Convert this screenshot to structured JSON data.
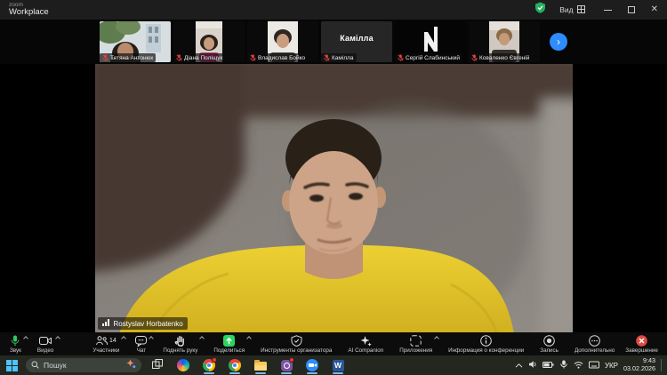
{
  "window": {
    "app_small": "zoom",
    "app_name": "Workplace",
    "view_label": "Вид",
    "icons": [
      "shield-check-icon",
      "grid-view-icon",
      "minimize-icon",
      "maximize-icon",
      "close-icon"
    ]
  },
  "filmstrip": {
    "participants": [
      {
        "name": "Тетяна Антонюк",
        "muted": true,
        "active_speaker": true
      },
      {
        "name": "Діана Поліщук",
        "muted": true
      },
      {
        "name": "Владислав Бойко",
        "muted": true
      },
      {
        "name": "Камілла",
        "center_label": "Камілла",
        "muted": true
      },
      {
        "name": "Сергій Слабинський",
        "muted": true,
        "logo": "N-monogram"
      },
      {
        "name": "Коваленко Євгеній",
        "muted": true
      }
    ],
    "next_arrow_icon": "chevron-right-icon"
  },
  "main_video": {
    "speaker": "Rostyslav Horbatenko",
    "signal_icon": "audio-level-bars-icon"
  },
  "toolbar": {
    "items": [
      {
        "label": "Звук",
        "icon": "microphone-icon",
        "chevron": true
      },
      {
        "label": "Видео",
        "icon": "camera-icon",
        "chevron": true
      },
      {
        "label": "Участники",
        "icon": "participants-icon",
        "count": "14",
        "chevron": true
      },
      {
        "label": "Чат",
        "icon": "chat-bubble-icon",
        "chevron": true
      },
      {
        "label": "Поднять руку",
        "icon": "raise-hand-icon",
        "chevron": true
      },
      {
        "label": "Поделиться",
        "icon": "share-screen-icon",
        "chevron": true
      },
      {
        "label": "Инструменты организатора",
        "icon": "shield-icon"
      },
      {
        "label": "AI Companion",
        "icon": "sparkle-icon"
      },
      {
        "label": "Приложения",
        "icon": "apps-icon",
        "chevron": true
      },
      {
        "label": "Информация о конференции",
        "icon": "info-icon"
      },
      {
        "label": "Запись",
        "icon": "record-icon"
      },
      {
        "label": "Дополнительно",
        "icon": "more-icon"
      },
      {
        "label": "Завершение",
        "icon": "end-call-icon"
      }
    ]
  },
  "taskbar": {
    "search_placeholder": "Пошук",
    "word_glyph": "W",
    "language": "УКР",
    "time": "9:43",
    "date": "03.02.2026",
    "app_icons": [
      "start-icon",
      "copilot-icon",
      "chrome-icon",
      "chrome-profile-icon",
      "file-explorer-icon",
      "viber-icon",
      "zoom-app-icon",
      "word-icon"
    ],
    "tray_icons": [
      "chevron-up-icon",
      "speaker-icon",
      "battery-icon",
      "microphone-icon",
      "wifi-icon",
      "keyboard-icon"
    ]
  },
  "colors": {
    "accent_green": "#23d959",
    "share_green": "#2bd45f",
    "end_red": "#dc4a41",
    "arrow_blue": "#2d8cff",
    "mic_muted_red": "#e0443f",
    "taskbar_accent": "#79b8e8"
  }
}
